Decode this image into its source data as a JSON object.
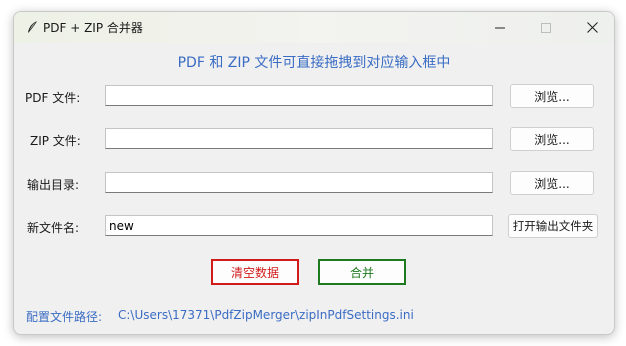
{
  "window": {
    "title": "PDF + ZIP 合并器",
    "icon": "feather-icon"
  },
  "heading": "PDF 和 ZIP 文件可直接拖拽到对应输入框中",
  "rows": [
    {
      "label": "PDF 文件:",
      "value": "",
      "button": "浏览..."
    },
    {
      "label": "ZIP 文件:",
      "value": "",
      "button": "浏览..."
    },
    {
      "label": "输出目录:",
      "value": "",
      "button": "浏览..."
    },
    {
      "label": "新文件名:",
      "value": "new",
      "button": "打开输出文件夹"
    }
  ],
  "actions": {
    "clear": "清空数据",
    "merge": "合并"
  },
  "config": {
    "label": "配置文件路径:",
    "path": "C:\\Users\\17371\\PdfZipMerger\\zipInPdfSettings.ini"
  },
  "colors": {
    "accent": "#3a6cc4",
    "clear": "#d11a1a",
    "merge": "#1e7a1e"
  }
}
